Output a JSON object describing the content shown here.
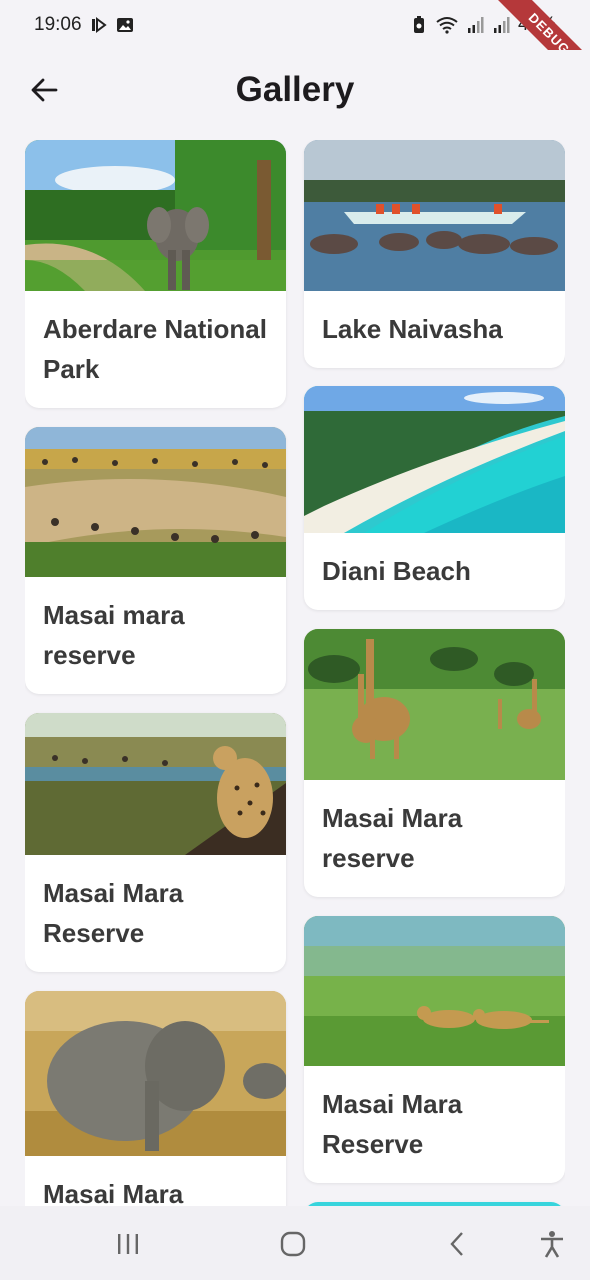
{
  "status_bar": {
    "time": "19:06",
    "battery": "49%"
  },
  "debug_banner": "DEBUG",
  "app_bar": {
    "title": "Gallery"
  },
  "gallery": {
    "left": [
      {
        "title": "Aberdare National Park"
      },
      {
        "title": "Masai mara reserve"
      },
      {
        "title": "Masai Mara Reserve"
      },
      {
        "title": "Masai  Mara"
      }
    ],
    "right": [
      {
        "title": "Lake Naivasha"
      },
      {
        "title": "Diani Beach"
      },
      {
        "title": "Masai Mara reserve"
      },
      {
        "title": "Masai Mara Reserve"
      }
    ]
  },
  "colors": {
    "background": "#f4f3f7",
    "card": "#ffffff",
    "title_text": "#1d1b1e",
    "card_text": "#3a3a3a",
    "debug_ribbon": "#b5383a"
  },
  "icons": {
    "back": "arrow-left-icon",
    "nav_recents": "recents-icon",
    "nav_home": "home-icon",
    "nav_back": "chevron-left-icon",
    "nav_accessibility": "accessibility-icon"
  }
}
